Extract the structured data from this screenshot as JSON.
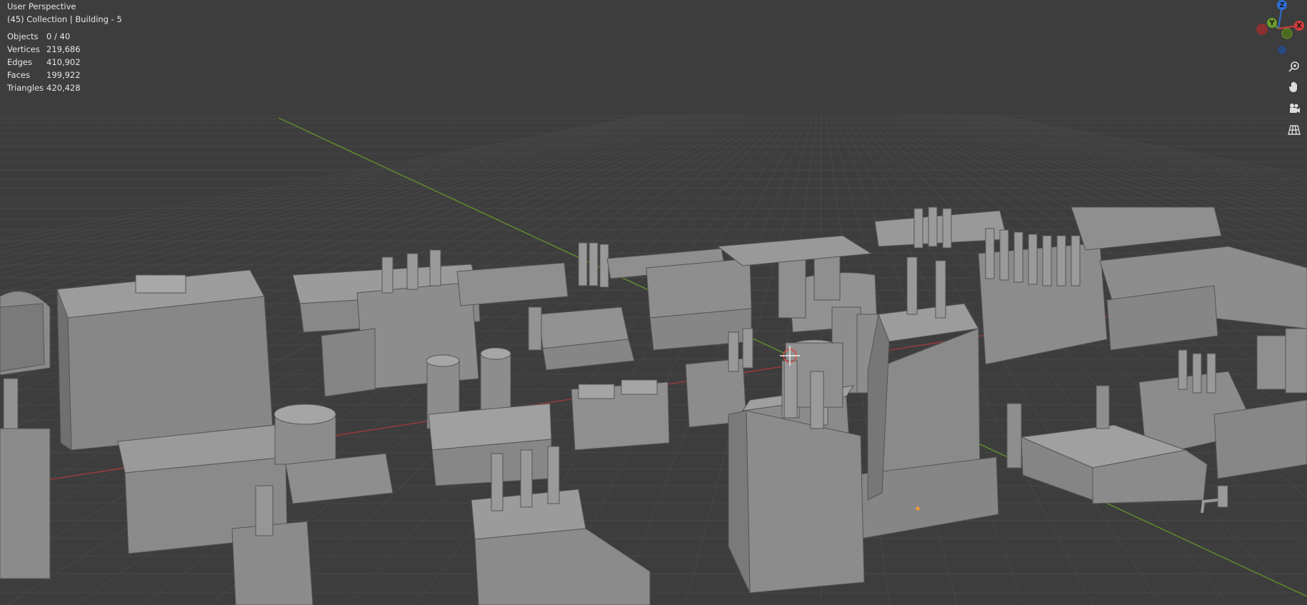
{
  "viewport": {
    "view_name": "User Perspective",
    "collection_info": "(45) Collection | Building - 5",
    "background_color": "#3d3d3d",
    "grid_color": "#4a4a4a",
    "x_axis_color": "#9a3a3a",
    "y_axis_color": "#5f8a2c"
  },
  "stats": [
    {
      "label": "Objects",
      "value": "0 / 40"
    },
    {
      "label": "Vertices",
      "value": "219,686"
    },
    {
      "label": "Edges",
      "value": "410,902"
    },
    {
      "label": "Faces",
      "value": "199,922"
    },
    {
      "label": "Triangles",
      "value": "420,428"
    }
  ],
  "gizmo": {
    "z_label": "Z",
    "y_label": "Y",
    "x_label": "X",
    "z_color": "#2e6fd6",
    "y_color": "#6a9a2a",
    "x_color": "#d23c3c"
  },
  "nav_tools": [
    {
      "name": "zoom-icon"
    },
    {
      "name": "hand-pan-icon"
    },
    {
      "name": "camera-view-icon"
    },
    {
      "name": "grid-ortho-icon"
    }
  ]
}
